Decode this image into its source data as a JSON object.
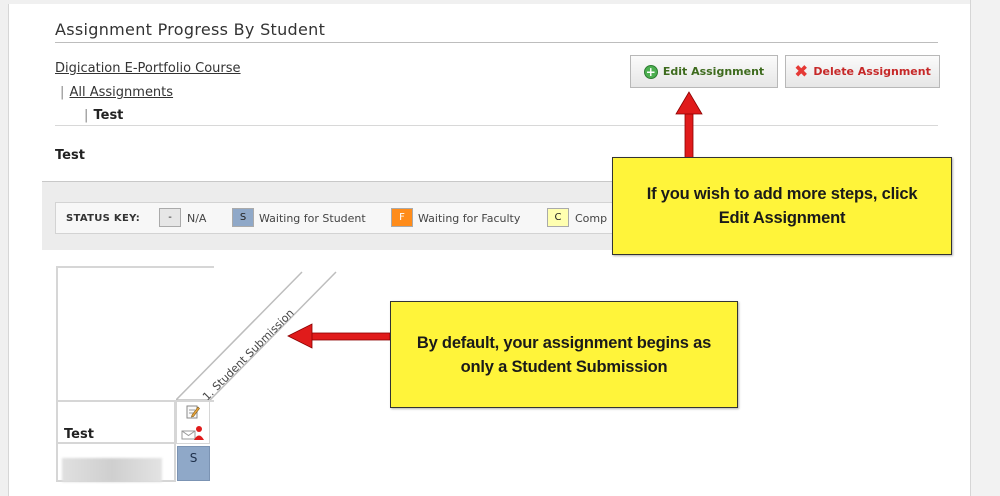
{
  "page": {
    "title": "Assignment Progress By Student",
    "breadcrumb": {
      "course": "Digication E-Portfolio Course",
      "all": "All Assignments",
      "current": "Test",
      "sep": "|"
    },
    "section_title": "Test"
  },
  "toolbar": {
    "edit_label": "Edit Assignment",
    "delete_label": "Delete Assignment"
  },
  "status_key": {
    "label": "STATUS KEY:",
    "items": [
      {
        "code": "-",
        "text": "N/A",
        "color": "#e6e6e6"
      },
      {
        "code": "S",
        "text": "Waiting for Student",
        "color": "#8fa8c8"
      },
      {
        "code": "F",
        "text": "Waiting for Faculty",
        "color": "#ff8c1a"
      },
      {
        "code": "C",
        "text": "Comp",
        "color": "#ffffb0"
      }
    ]
  },
  "grid": {
    "step_header": "1. Student Submission",
    "row_label": "Test",
    "cell_status": "S"
  },
  "callouts": {
    "edit": "If you wish to add more steps, click Edit Assignment",
    "default": "By default, your assignment begins as only a Student Submission"
  },
  "colors": {
    "callout_bg": "#fff43a",
    "arrow": "#e01b1b",
    "status_student": "#8fa8c8"
  }
}
